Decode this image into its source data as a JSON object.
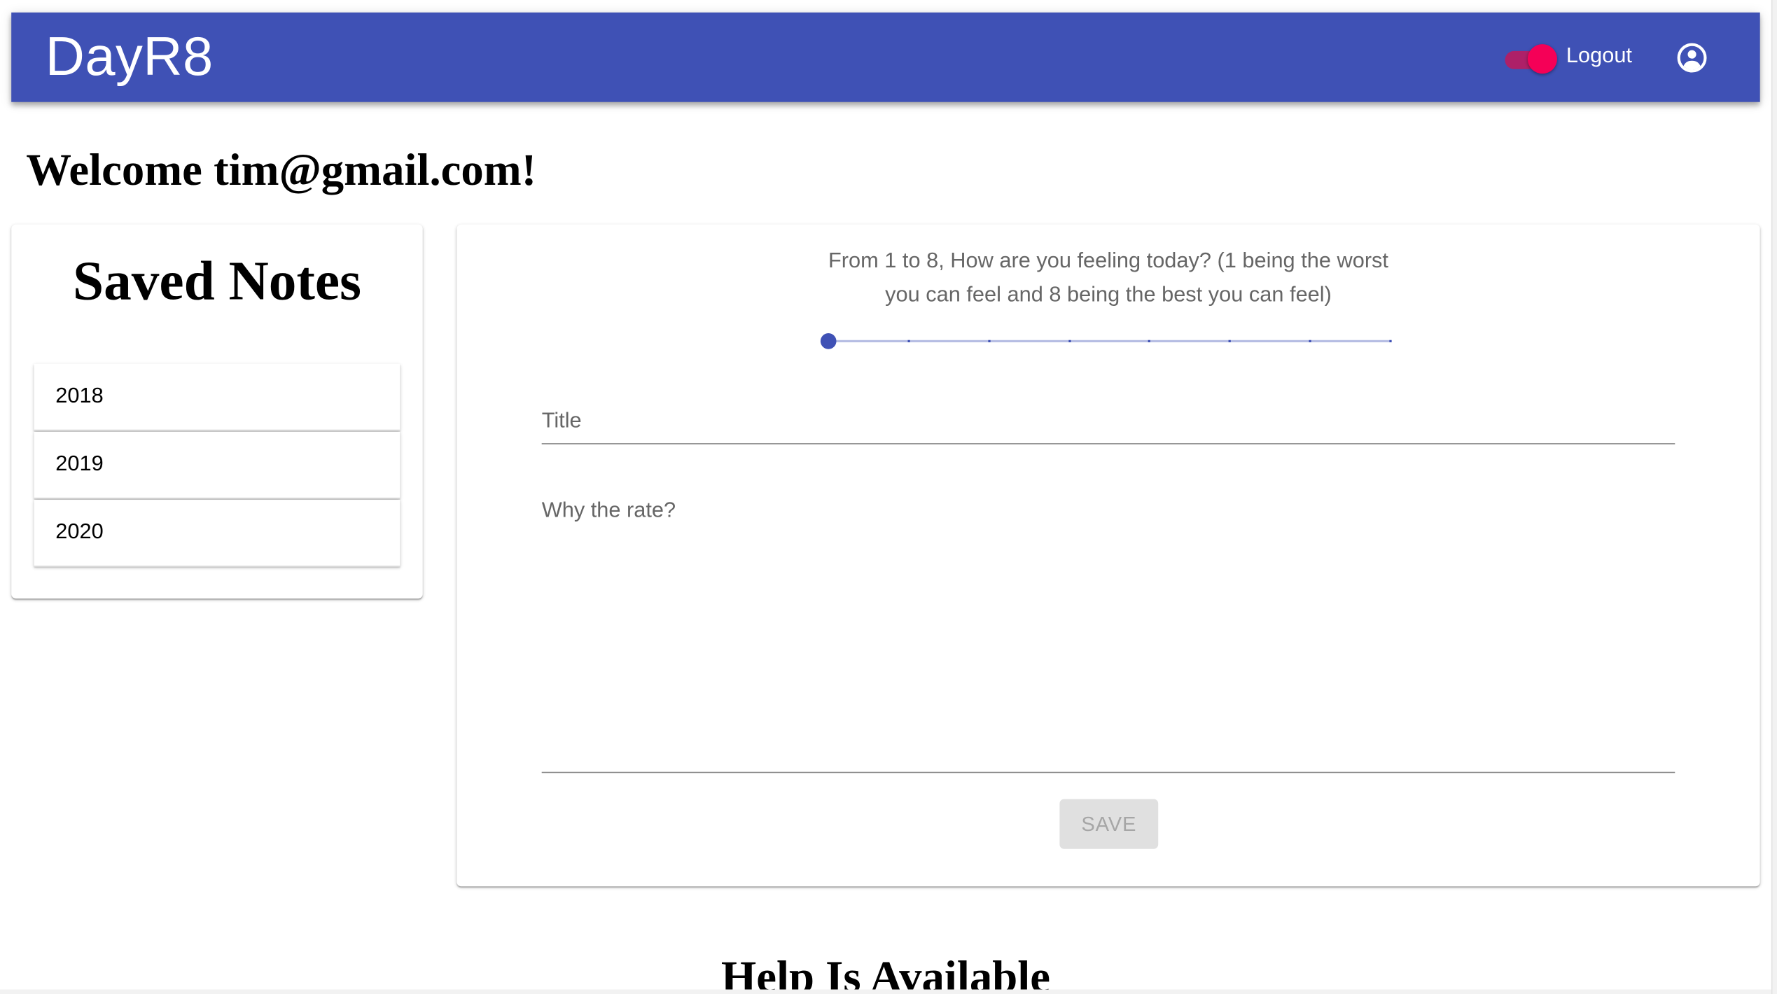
{
  "header": {
    "app_title": "DayR8",
    "logout_label": "Logout",
    "toggle_on": true,
    "account_icon": "account-circle-icon",
    "colors": {
      "primary": "#3f51b5",
      "accent": "#f50057"
    }
  },
  "welcome": "Welcome tim@gmail.com!",
  "saved_notes": {
    "title": "Saved Notes",
    "years": [
      {
        "label": "2018"
      },
      {
        "label": "2019"
      },
      {
        "label": "2020"
      }
    ]
  },
  "entry_form": {
    "prompt": "From 1 to 8, How are you feeling today? (1 being the worst you can feel and 8 being the best you can feel)",
    "slider": {
      "min": 1,
      "max": 8,
      "value": 1
    },
    "title_placeholder": "Title",
    "reason_placeholder": "Why the rate?",
    "save_label": "SAVE",
    "save_disabled": true
  },
  "help_heading": "Help Is Available"
}
